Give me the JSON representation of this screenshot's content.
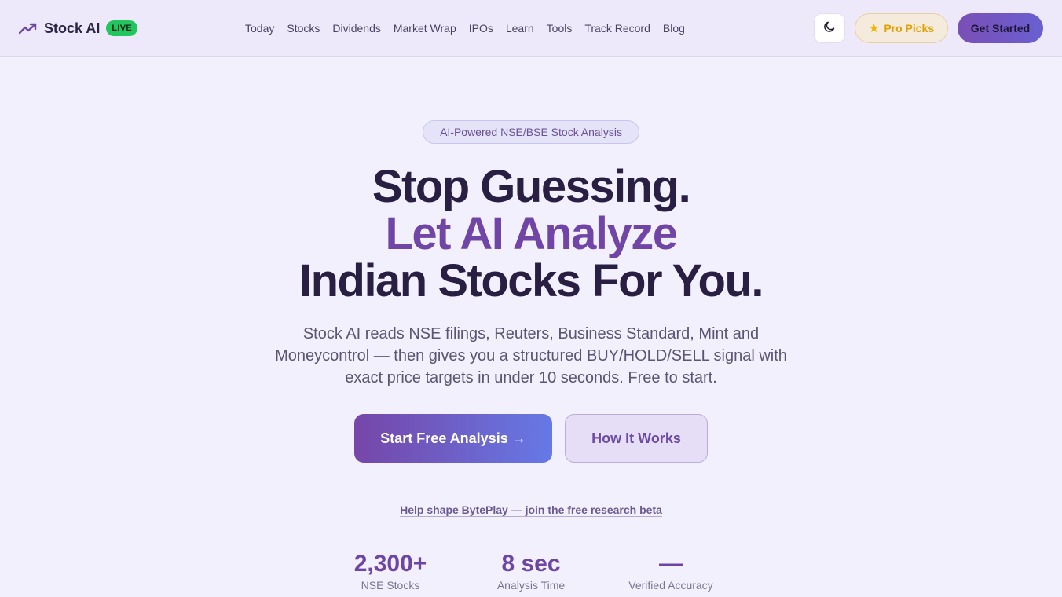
{
  "brand": {
    "name": "Stock AI",
    "live_badge": "LIVE",
    "icon": "trending-up-icon",
    "accent": "#6d46a4"
  },
  "nav": {
    "links": [
      "Today",
      "Stocks",
      "Dividends",
      "Market Wrap",
      "IPOs",
      "Learn",
      "Tools",
      "Track Record",
      "Blog"
    ],
    "theme_toggle_icon": "moon-icon",
    "pro_picks_label": "Pro Picks",
    "pro_picks_icon": "star-icon",
    "get_started_label": "Get Started"
  },
  "hero": {
    "pill": "AI-Powered NSE/BSE Stock Analysis",
    "headline_line1": "Stop Guessing.",
    "headline_line2": "Let AI Analyze",
    "headline_line3": "Indian Stocks For You.",
    "subtext": "Stock AI reads NSE filings, Reuters, Business Standard, Mint and Moneycontrol — then gives you a structured BUY/HOLD/SELL signal with exact price targets in under 10 seconds. Free to start.",
    "cta_primary": "Start Free Analysis →",
    "cta_secondary": "How It Works",
    "beta_link": "Help shape BytePlay — join the free research beta"
  },
  "stats": [
    {
      "value": "2,300+",
      "label": "NSE Stocks"
    },
    {
      "value": "8 sec",
      "label": "Analysis Time"
    },
    {
      "value": "—",
      "label": "Verified Accuracy"
    }
  ]
}
